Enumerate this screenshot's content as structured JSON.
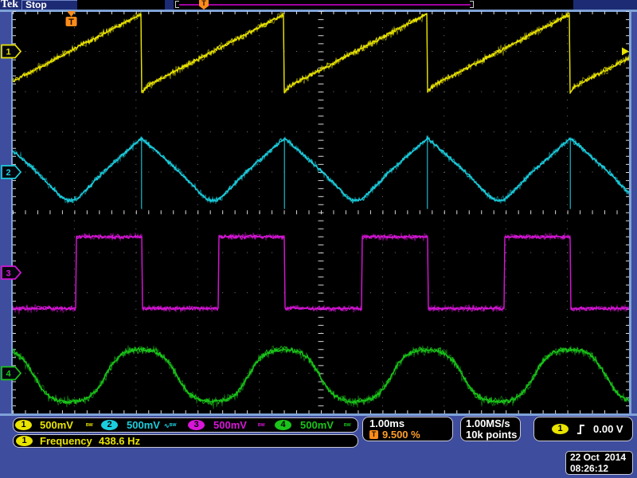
{
  "header": {
    "logo": "Tek",
    "acq_status": "Stop"
  },
  "preview_bar": {
    "trigger_flag": "T"
  },
  "chart_data": {
    "type": "line",
    "title": "Oscilloscope 4-channel capture",
    "x_axis": {
      "divisions": 10,
      "timebase_per_div": "1.00ms"
    },
    "y_axis": {
      "divisions": 10
    },
    "trigger": {
      "source": "1",
      "slope": "rising",
      "level": "0.00 V",
      "position_pct": 9.5,
      "flag": "T"
    },
    "measured_frequency_hz": 438.6,
    "signal_period_div": 2.32,
    "channels": [
      {
        "id": "1",
        "scale": "500mV",
        "color": "#E9E400",
        "waveform": "sawtooth",
        "marker_div": 1.0,
        "center_div": 1.0,
        "amplitude_div": 0.93,
        "noise_div": 0.048,
        "badges": "ᴮᵂ"
      },
      {
        "id": "2",
        "scale": "500mV",
        "color": "#1BCEDE",
        "waveform": "triangle",
        "marker_div": 4.0,
        "center_div": 3.94,
        "amplitude_div": 0.78,
        "noise_div": 0.043,
        "badges": "∿ᴮᵂ"
      },
      {
        "id": "3",
        "scale": "500mV",
        "color": "#D816D8",
        "waveform": "square",
        "marker_div": 6.5,
        "center_div": 6.5,
        "amplitude_div": 0.89,
        "noise_div": 0.04,
        "badges": "ᴮᵂ"
      },
      {
        "id": "4",
        "scale": "500mV",
        "color": "#1AC41A",
        "waveform": "sine",
        "marker_div": 9.0,
        "center_div": 9.06,
        "amplitude_div": 0.645,
        "noise_div": 0.058,
        "badges": "ᴮᵂ"
      }
    ]
  },
  "readouts": {
    "horizontal": {
      "scale": "1.00ms",
      "position": "9.500 %",
      "delay_flag": "T"
    },
    "acquisition": {
      "rate": "1.00MS/s",
      "points": "10k points"
    },
    "trigger": {
      "channel": "1",
      "level": "0.00 V"
    },
    "measurement": {
      "channel": "1",
      "name": "Frequency",
      "value": "438.6 Hz"
    },
    "datetime": {
      "date": "22 Oct  2014",
      "time": "08:26:12"
    }
  }
}
